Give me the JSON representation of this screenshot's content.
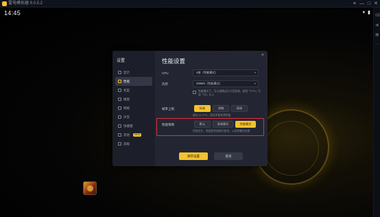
{
  "window": {
    "title": "雷电模拟器 9.0.5.2",
    "icons": [
      "≡",
      "—",
      "□",
      "✕"
    ]
  },
  "status_bar": {
    "time": "14:45",
    "icons": [
      "▾",
      "▮"
    ]
  },
  "dialog": {
    "title": "设置",
    "main_title": "性能设置",
    "close": "×",
    "nav": [
      {
        "label": "显示",
        "icon": "monitor-icon"
      },
      {
        "label": "性能",
        "icon": "performance-icon",
        "active": true
      },
      {
        "label": "机型",
        "icon": "phone-icon"
      },
      {
        "label": "磁盘",
        "icon": "disk-icon"
      },
      {
        "label": "网络",
        "icon": "network-icon"
      },
      {
        "label": "声音",
        "icon": "sound-icon"
      },
      {
        "label": "快捷键",
        "icon": "keyboard-icon"
      },
      {
        "label": "其他",
        "icon": "other-icon",
        "badge": "NEW"
      },
      {
        "label": "高级",
        "icon": "advanced-icon"
      }
    ],
    "cpu": {
      "label": "CPU",
      "value": "4核（性能模式）"
    },
    "memory": {
      "label": "内存",
      "value": "4096M（性能模式）"
    },
    "check_text": "性能模式下，可以流畅运行大型游戏，游戏「FPS」可选「60」以上",
    "fps": {
      "label": "帧率上限",
      "options": [
        "标准",
        "流畅",
        "高帧"
      ],
      "selected": 0,
      "hint": "建议 60 FPS，高帧率更耗费性能"
    },
    "perf_mode": {
      "label": "性能策略",
      "options": [
        "默认",
        "高效模式",
        "性能模式"
      ],
      "selected": 2,
      "hint": "性能优先，需搭配性能模式使用，以获得最佳效果"
    },
    "save_label": "保存设置",
    "cancel_label": "取消"
  },
  "colors": {
    "accent": "#f3c22d",
    "highlight": "#e0303f",
    "panel": "#232632"
  }
}
